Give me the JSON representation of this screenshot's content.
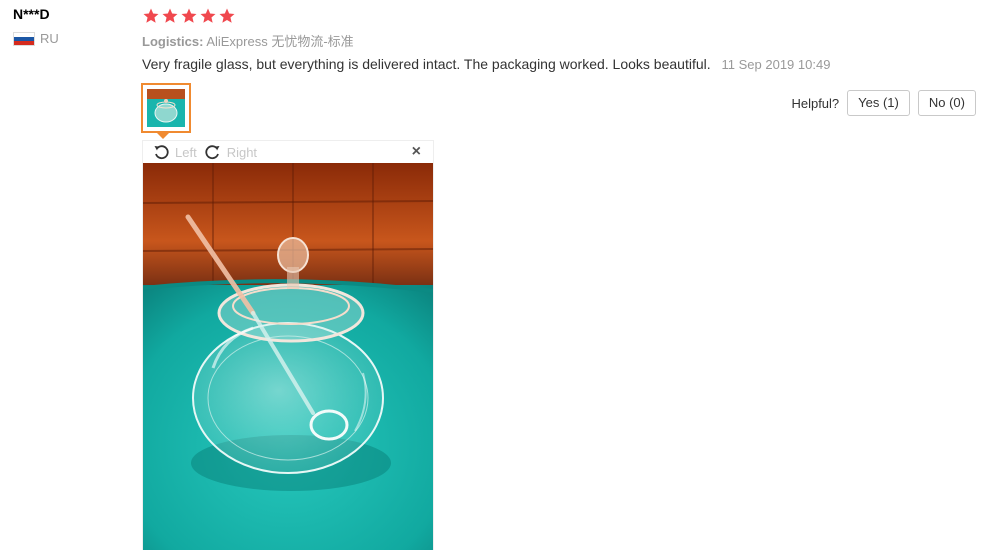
{
  "user": {
    "name": "N***D",
    "country": "RU",
    "flag_icon": "russia-flag-icon"
  },
  "rating": {
    "stars": 5,
    "max": 5,
    "color": "#f0484e"
  },
  "logistics": {
    "label": "Logistics:",
    "value": "AliExpress 无忧物流-标准"
  },
  "feedback": {
    "text": "Very fragile glass, but everything is delivered intact. The packaging worked. Looks beautiful.",
    "date": "11 Sep 2019 10:49"
  },
  "helpful": {
    "label": "Helpful?",
    "yes": "Yes (1)",
    "no": "No (0)"
  },
  "viewer": {
    "rotate_left": "Left",
    "rotate_right": "Right",
    "close_symbol": "×",
    "accent_color": "#f08a30"
  }
}
